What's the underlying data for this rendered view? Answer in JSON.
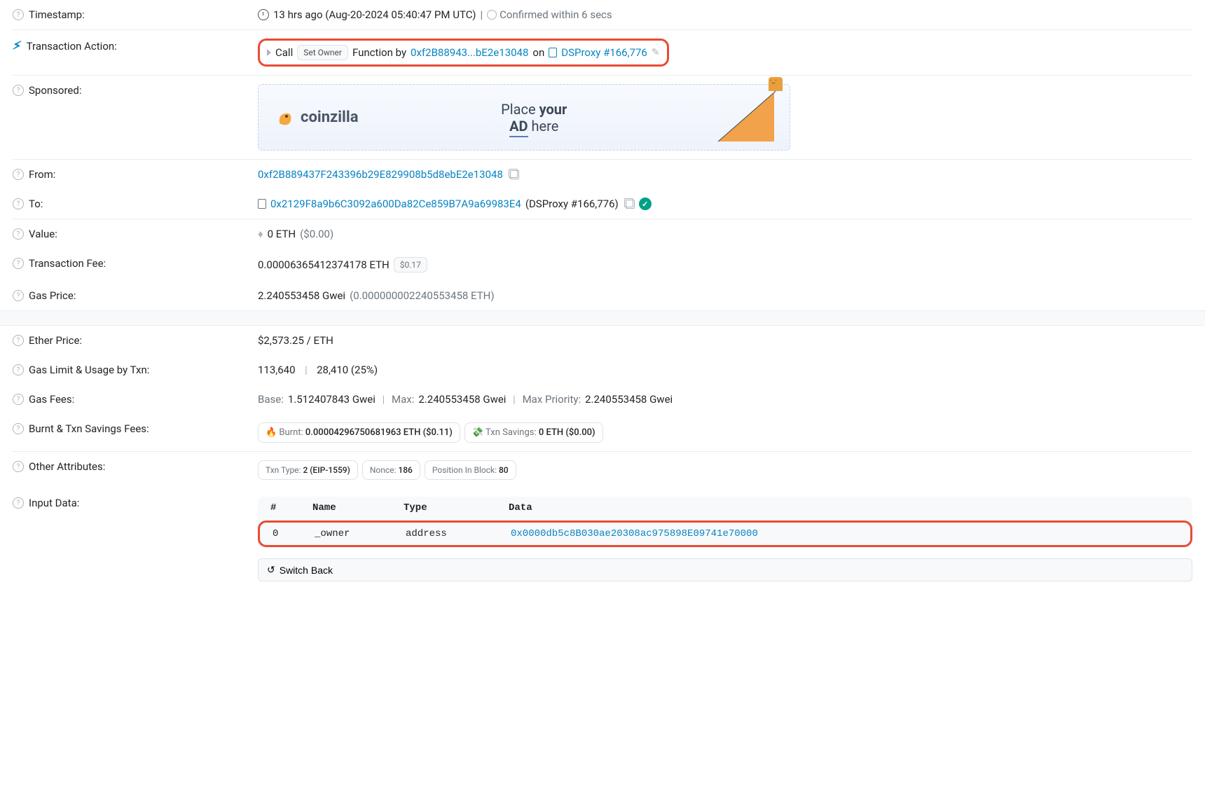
{
  "timestamp": {
    "label": "Timestamp:",
    "ago": "13 hrs ago (Aug-20-2024 05:40:47 PM UTC)",
    "confirmed": "Confirmed within 6 secs"
  },
  "action": {
    "label": "Transaction Action:",
    "call": "Call",
    "method": "Set Owner",
    "function_by": "Function by",
    "from_short": "0xf2B88943...bE2e13048",
    "on": "on",
    "contract": "DSProxy #166,776"
  },
  "sponsored": {
    "label": "Sponsored:",
    "logo": "coinzilla",
    "text1": "Place",
    "text2": "your",
    "text3": "AD",
    "text4": "here"
  },
  "from": {
    "label": "From:",
    "addr": "0xf2B889437F243396b29E829908b5d8ebE2e13048"
  },
  "to": {
    "label": "To:",
    "addr": "0x2129F8a9b6C3092a600Da82Ce859B7A9a69983E4",
    "paren": "(DSProxy #166,776)"
  },
  "value": {
    "label": "Value:",
    "eth": "0 ETH",
    "usd": "($0.00)"
  },
  "fee": {
    "label": "Transaction Fee:",
    "eth": "0.00006365412374178 ETH",
    "usd": "$0.17"
  },
  "gas_price": {
    "label": "Gas Price:",
    "gwei": "2.240553458 Gwei",
    "paren": "(0.000000002240553458 ETH)"
  },
  "eth_price": {
    "label": "Ether Price:",
    "value": "$2,573.25 / ETH"
  },
  "gas_limit": {
    "label": "Gas Limit & Usage by Txn:",
    "limit": "113,640",
    "usage": "28,410 (25%)"
  },
  "gas_fees": {
    "label": "Gas Fees:",
    "base_l": "Base:",
    "base_v": "1.512407843 Gwei",
    "max_l": "Max:",
    "max_v": "2.240553458 Gwei",
    "maxp_l": "Max Priority:",
    "maxp_v": "2.240553458 Gwei"
  },
  "burnt": {
    "label": "Burnt & Txn Savings Fees:",
    "burnt_l": "Burnt:",
    "burnt_v": "0.00004296750681963 ETH ($0.11)",
    "save_l": "Txn Savings:",
    "save_v": "0 ETH ($0.00)"
  },
  "attrs": {
    "label": "Other Attributes:",
    "txn_type_l": "Txn Type:",
    "txn_type_v": "2 (EIP-1559)",
    "nonce_l": "Nonce:",
    "nonce_v": "186",
    "pos_l": "Position In Block:",
    "pos_v": "80"
  },
  "input": {
    "label": "Input Data:",
    "headers": {
      "idx": "#",
      "name": "Name",
      "type": "Type",
      "data": "Data"
    },
    "row": {
      "idx": "0",
      "name": "_owner",
      "type": "address",
      "data": "0x0000db5c8B030ae20308ac975898E09741e70000"
    },
    "switch": "Switch Back"
  }
}
